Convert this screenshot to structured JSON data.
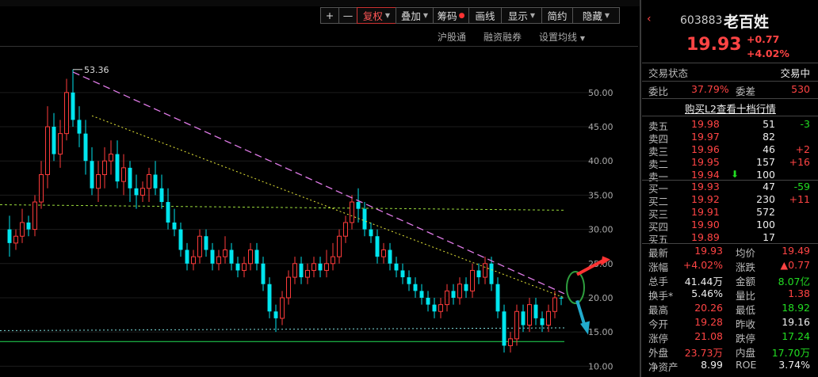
{
  "toolbar": {
    "plus": "+",
    "minus": "—",
    "fuquan": "复权",
    "diejia": "叠加",
    "choumA": "筹码",
    "huaxian": "画线",
    "xianshi": "显示",
    "jianyue": "简约",
    "yincang": "隐藏"
  },
  "subbar": {
    "hgt": "沪股通",
    "rzrq": "融资融券",
    "szjx": "设置均线"
  },
  "stock": {
    "code": "603883",
    "name": "老百姓",
    "price": "19.93",
    "change": "+0.77",
    "change_pct": "+4.02%"
  },
  "status": {
    "label": "交易状态",
    "value": "交易中"
  },
  "weibi": {
    "label": "委比",
    "value": "37.79%",
    "label2": "委差",
    "value2": "530"
  },
  "l2_link": "购买L2查看十档行情",
  "asks": [
    {
      "label": "卖五",
      "price": "19.98",
      "vol": "51",
      "delta": "-3",
      "delta_color": "green"
    },
    {
      "label": "卖四",
      "price": "19.97",
      "vol": "82",
      "delta": "",
      "delta_color": ""
    },
    {
      "label": "卖三",
      "price": "19.96",
      "vol": "46",
      "delta": "+2",
      "delta_color": "red"
    },
    {
      "label": "卖二",
      "price": "19.95",
      "vol": "157",
      "delta": "+16",
      "delta_color": "red"
    },
    {
      "label": "卖一",
      "price": "19.94",
      "vol": "100",
      "delta": "",
      "delta_color": ""
    }
  ],
  "bids": [
    {
      "label": "买一",
      "price": "19.93",
      "vol": "47",
      "delta": "-59",
      "delta_color": "green"
    },
    {
      "label": "买二",
      "price": "19.92",
      "vol": "230",
      "delta": "+11",
      "delta_color": "red"
    },
    {
      "label": "买三",
      "price": "19.91",
      "vol": "572",
      "delta": "",
      "delta_color": ""
    },
    {
      "label": "买四",
      "price": "19.90",
      "vol": "100",
      "delta": "",
      "delta_color": ""
    },
    {
      "label": "买五",
      "price": "19.89",
      "vol": "17",
      "delta": "",
      "delta_color": ""
    }
  ],
  "stats": [
    {
      "l1": "最新",
      "v1": "19.93",
      "c1": "red",
      "l2": "均价",
      "v2": "19.49",
      "c2": "red"
    },
    {
      "l1": "涨幅",
      "v1": "+4.02%",
      "c1": "red",
      "l2": "涨跌",
      "v2": "▲0.77",
      "c2": "red"
    },
    {
      "l1": "总手",
      "v1": "41.44万",
      "c1": "white",
      "l2": "金额",
      "v2": "8.07亿",
      "c2": "green"
    },
    {
      "l1": "换手*",
      "v1": "5.46%",
      "c1": "white",
      "l2": "量比",
      "v2": "1.38",
      "c2": "red"
    },
    {
      "l1": "最高",
      "v1": "20.26",
      "c1": "red",
      "l2": "最低",
      "v2": "18.92",
      "c2": "green"
    },
    {
      "l1": "今开",
      "v1": "19.28",
      "c1": "red",
      "l2": "昨收",
      "v2": "19.16",
      "c2": "white"
    },
    {
      "l1": "涨停",
      "v1": "21.08",
      "c1": "red",
      "l2": "跌停",
      "v2": "17.24",
      "c2": "green"
    },
    {
      "l1": "外盘",
      "v1": "23.73万",
      "c1": "red",
      "l2": "内盘",
      "v2": "17.70万",
      "c2": "green"
    },
    {
      "l1": "净资产",
      "v1": "8.99",
      "c1": "white",
      "l2": "ROE",
      "v2": "3.74%",
      "c2": "white"
    }
  ],
  "chart_data": {
    "type": "candlestick",
    "y_ticks": [
      "50.00",
      "45.00",
      "40.00",
      "35.00",
      "30.00",
      "25.00",
      "20.00",
      "15.00",
      "10.00"
    ],
    "ylim": [
      9,
      56
    ],
    "max_label": "53.36",
    "colors": {
      "up": "#ff3b3b",
      "down": "#00e5ee",
      "trend1": "#e07be8",
      "trend2": "#e8e838",
      "level": "#9bdc3c",
      "support": "#22dd55"
    },
    "candles": [
      [
        30,
        28,
        32,
        26
      ],
      [
        28,
        29,
        30,
        27
      ],
      [
        29,
        31,
        33,
        28
      ],
      [
        31,
        30,
        32,
        29
      ],
      [
        30,
        34,
        35,
        29
      ],
      [
        34,
        38,
        40,
        33
      ],
      [
        38,
        45,
        48,
        36
      ],
      [
        45,
        41,
        47,
        40
      ],
      [
        41,
        44,
        46,
        39
      ],
      [
        44,
        50,
        52,
        43
      ],
      [
        50,
        46,
        53.36,
        45
      ],
      [
        46,
        44,
        48,
        42
      ],
      [
        44,
        40,
        46,
        38
      ],
      [
        40,
        36,
        42,
        35
      ],
      [
        36,
        38,
        40,
        34
      ],
      [
        38,
        40,
        42,
        36
      ],
      [
        40,
        41,
        43,
        38
      ],
      [
        41,
        37,
        43,
        36
      ],
      [
        37,
        39,
        41,
        35
      ],
      [
        39,
        36,
        40,
        34
      ],
      [
        36,
        35,
        38,
        33
      ],
      [
        35,
        36,
        37,
        34
      ],
      [
        36,
        38,
        39,
        34
      ],
      [
        38,
        36,
        40,
        35
      ],
      [
        36,
        34,
        38,
        33
      ],
      [
        34,
        31,
        36,
        30
      ],
      [
        31,
        30,
        33,
        29
      ],
      [
        30,
        27,
        31,
        26
      ],
      [
        27,
        25,
        28,
        24
      ],
      [
        25,
        26,
        27,
        24
      ],
      [
        26,
        29,
        30,
        25
      ],
      [
        29,
        27,
        30,
        26
      ],
      [
        27,
        25,
        28,
        24
      ],
      [
        25,
        26,
        27,
        24
      ],
      [
        26,
        27,
        29,
        25
      ],
      [
        27,
        25,
        28,
        24
      ],
      [
        25,
        24,
        26,
        23
      ],
      [
        24,
        25,
        26,
        23
      ],
      [
        25,
        27,
        28,
        24
      ],
      [
        27,
        25,
        28,
        24
      ],
      [
        25,
        22,
        26,
        21
      ],
      [
        22,
        18,
        23,
        17
      ],
      [
        18,
        17,
        19,
        15
      ],
      [
        17,
        20,
        21,
        16
      ],
      [
        20,
        23,
        24,
        19
      ],
      [
        23,
        25,
        26,
        22
      ],
      [
        25,
        23,
        26,
        22
      ],
      [
        23,
        24,
        25,
        22
      ],
      [
        24,
        25,
        26,
        23
      ],
      [
        25,
        24,
        26,
        23
      ],
      [
        24,
        25,
        27,
        23
      ],
      [
        25,
        26,
        28,
        24
      ],
      [
        26,
        29,
        30,
        25
      ],
      [
        29,
        31,
        32,
        28
      ],
      [
        31,
        34,
        35,
        30
      ],
      [
        34,
        33,
        36,
        31
      ],
      [
        33,
        30,
        34,
        29
      ],
      [
        30,
        29,
        31,
        28
      ],
      [
        29,
        26,
        30,
        25
      ],
      [
        26,
        27,
        28,
        25
      ],
      [
        27,
        25,
        28,
        24
      ],
      [
        25,
        24,
        26,
        23
      ],
      [
        24,
        23,
        25,
        22
      ],
      [
        23,
        22,
        24,
        21
      ],
      [
        22,
        21,
        23,
        20
      ],
      [
        21,
        20,
        22,
        19
      ],
      [
        20,
        19,
        21,
        18
      ],
      [
        19,
        18,
        20,
        17
      ],
      [
        18,
        19,
        20,
        17
      ],
      [
        19,
        21,
        22,
        18
      ],
      [
        21,
        20,
        22,
        19
      ],
      [
        20,
        22,
        23,
        19
      ],
      [
        22,
        21,
        23,
        20
      ],
      [
        21,
        24,
        25,
        20
      ],
      [
        24,
        23,
        25,
        22
      ],
      [
        23,
        25,
        26,
        22
      ],
      [
        25,
        22,
        26,
        21
      ],
      [
        22,
        18,
        23,
        17
      ],
      [
        18,
        13,
        19,
        12
      ],
      [
        13,
        14,
        15,
        12
      ],
      [
        14,
        18,
        19,
        13
      ],
      [
        18,
        16,
        19,
        15
      ],
      [
        16,
        19,
        20,
        15
      ],
      [
        19,
        17,
        20,
        16
      ],
      [
        17,
        16,
        18,
        15
      ],
      [
        16,
        18,
        19,
        15
      ],
      [
        18,
        20,
        21,
        17
      ],
      [
        20,
        19.93,
        20.26,
        18.92
      ]
    ]
  }
}
